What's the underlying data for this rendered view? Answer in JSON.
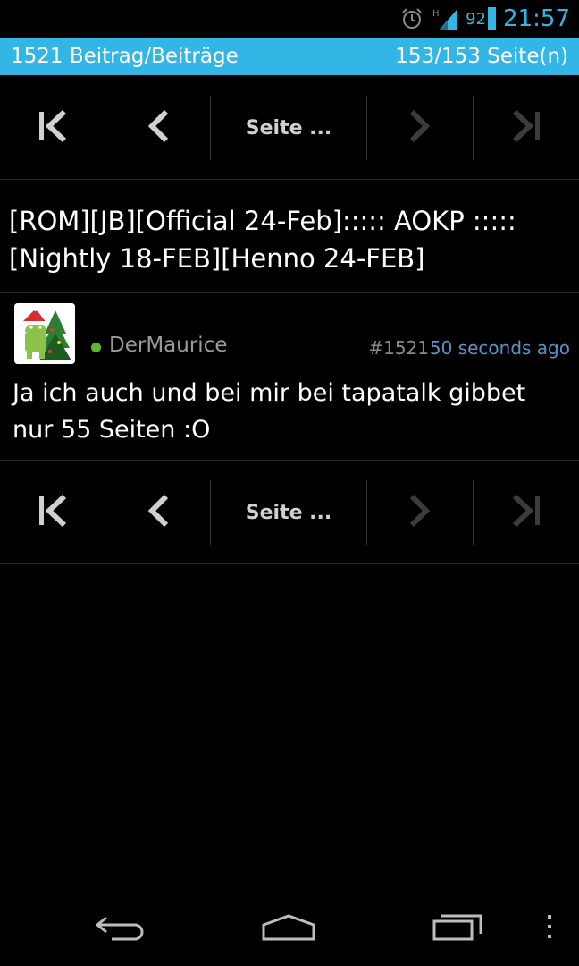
{
  "status_bar": {
    "icons": [
      "alarm-icon",
      "signal-icon",
      "battery-icon"
    ],
    "network_label": "H",
    "battery_level": "92",
    "time": "21:57"
  },
  "info_bar": {
    "posts_count": "1521 Beitrag/Beiträge",
    "pages": "153/153 Seite(n)"
  },
  "pagination": {
    "page_label": "Seite ...",
    "icons": [
      "first-page-icon",
      "previous-page-icon",
      "next-page-icon",
      "last-page-icon"
    ]
  },
  "thread": {
    "title": "[ROM][JB][Official 24-Feb]::::: AOKP :::::[Nightly 18-FEB][Henno 24-FEB]"
  },
  "post": {
    "username": "DerMaurice",
    "number": "#1521",
    "time": "50 seconds ago",
    "body": "Ja ich auch und bei mir bei tapatalk gibbet nur 55 Seiten :O"
  },
  "nav_bar": {
    "icons": [
      "back-icon",
      "home-icon",
      "recent-apps-icon",
      "overflow-menu-icon"
    ]
  },
  "colors": {
    "accent": "#33b5e5",
    "online": "#5cb82c",
    "timestamp": "#5b93c9",
    "disabled_icon": "#3c3c3c",
    "enabled_icon": "#d0d0d0"
  }
}
